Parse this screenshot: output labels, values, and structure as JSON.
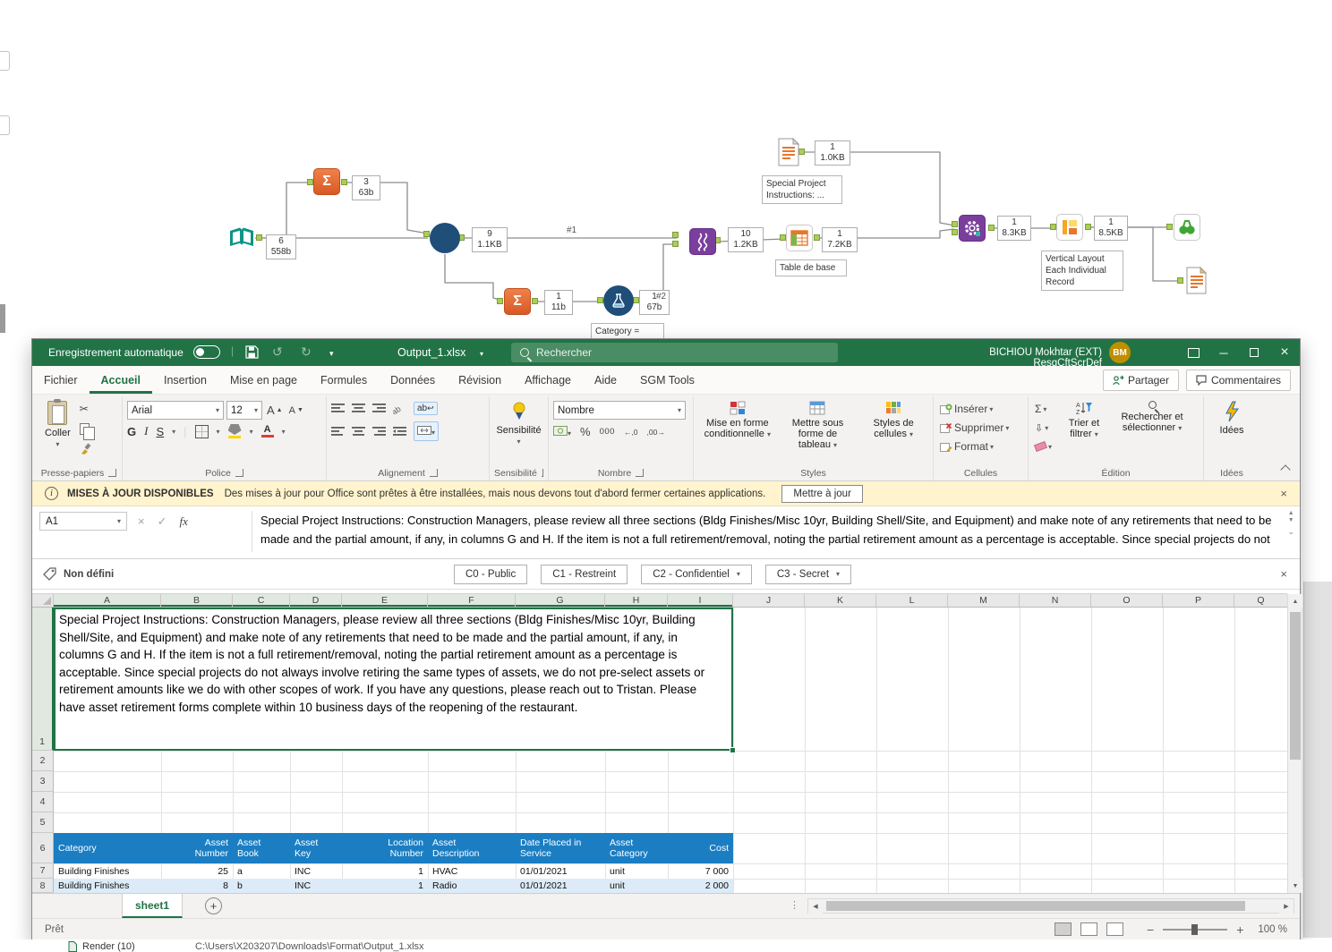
{
  "canvas": {
    "conn1": "#1",
    "conn2": "#2",
    "ann": {
      "input": {
        "c": "6",
        "s": "558b"
      },
      "sum1": {
        "c": "3",
        "s": "63b"
      },
      "circle": {
        "c": "9",
        "s": "1.1KB"
      },
      "sum2": {
        "c": "1",
        "s": "11b"
      },
      "formula": {
        "c": "1",
        "s": "67b"
      },
      "transpose": {
        "c": "10",
        "s": "1.2KB"
      },
      "table": {
        "c": "1",
        "s": "7.2KB"
      },
      "doc": {
        "c": "1",
        "s": "1.0KB"
      },
      "gear": {
        "c": "1",
        "s": "8.3KB"
      },
      "layout": {
        "c": "1",
        "s": "8.5KB"
      }
    },
    "labels": {
      "special": "Special Project\nInstructions: ...",
      "table": "Table de base",
      "layout": "Vertical Layout\nEach Individual\nRecord",
      "category": "Category ="
    }
  },
  "excel": {
    "titlebar": {
      "autosave": "Enregistrement automatique",
      "filename": "Output_1.xlsx",
      "search": "Rechercher",
      "user": "BICHIOU Mokhtar (EXT) ResgCftScrDef",
      "avatar": "BM"
    },
    "menu": {
      "tabs": [
        "Fichier",
        "Accueil",
        "Insertion",
        "Mise en page",
        "Formules",
        "Données",
        "Révision",
        "Affichage",
        "Aide",
        "SGM Tools"
      ],
      "share": "Partager",
      "comments": "Commentaires"
    },
    "ribbon": {
      "paste": "Coller",
      "clipboard_group": "Presse-papiers",
      "font_name": "Arial",
      "font_size": "12",
      "bold": "G",
      "italic": "I",
      "underline": "S",
      "font_group": "Police",
      "align_group": "Alignement",
      "wrap": "ab",
      "sensitivity": "Sensibilité",
      "sensitivity_group": "Sensibilité",
      "number_format": "Nombre",
      "percent": "%",
      "zeros": "000",
      "dec_left": "←,0",
      "dec_right": ",00→",
      "number_group": "Nombre",
      "cond_format": "Mise en forme conditionnelle",
      "format_table": "Mettre sous forme de tableau",
      "cell_styles": "Styles de cellules",
      "styles_group": "Styles",
      "insert": "Insérer",
      "delete": "Supprimer",
      "format": "Format",
      "cells_group": "Cellules",
      "sigma": "Σ",
      "sort_filter": "Trier et filtrer",
      "find_select": "Rechercher et sélectionner",
      "edit_group": "Édition",
      "ideas": "Idées",
      "ideas_group": "Idées"
    },
    "notif": {
      "title": "MISES À JOUR DISPONIBLES",
      "message": "Des mises à jour pour Office sont prêtes à être installées, mais nous devons tout d'abord fermer certaines applications.",
      "action": "Mettre à jour"
    },
    "formula": {
      "cell_ref": "A1",
      "fx": "fx"
    },
    "classification": {
      "label": "Non défini",
      "c0": "C0 - Public",
      "c1": "C1 - Restreint",
      "c2": "C2 - Confidentiel",
      "c3": "C3 - Secret"
    },
    "grid": {
      "columns": [
        "A",
        "B",
        "C",
        "D",
        "E",
        "F",
        "G",
        "H",
        "I",
        "J",
        "K",
        "L",
        "M",
        "N",
        "O",
        "P",
        "Q"
      ],
      "rows": [
        "1",
        "2",
        "3",
        "4",
        "5",
        "6",
        "7",
        "8"
      ],
      "a1_text": "Special Project Instructions: Construction Managers, please review all three sections (Bldg Finishes/Misc 10yr, Building Shell/Site, and Equipment) and make note of any retirements that need to be made and the partial amount, if any, in columns G and H. If the item is not a full retirement/removal, noting the partial retirement amount as a percentage is acceptable. Since special projects do not always involve retiring the same types of assets, we do not pre-select assets or retirement amounts like we do with other scopes of work. If you have any questions, please reach out to Tristan. Please have asset retirement forms complete within 10 business days of the reopening of the restaurant.",
      "headers": [
        "Category",
        "Asset\nNumber",
        "Asset\nBook",
        "Asset\nKey",
        "Location\nNumber",
        "Asset\nDescription",
        "Date Placed in\nService",
        "Asset\nCategory",
        "Cost"
      ],
      "data": [
        [
          "Building Finishes",
          "25",
          "a",
          "INC",
          "1",
          "HVAC",
          "01/01/2021",
          "unit",
          "7 000"
        ],
        [
          "Building Finishes",
          "8",
          "b",
          "INC",
          "1",
          "Radio",
          "01/01/2021",
          "unit",
          "2 000"
        ]
      ]
    },
    "tabs": {
      "sheet": "sheet1"
    },
    "status": {
      "ready": "Prêt",
      "zoom": "100 %"
    }
  },
  "fragments": {
    "render_label": "Render (10)",
    "path": "C:\\Users\\X203207\\Downloads\\Format\\Output_1.xlsx"
  }
}
